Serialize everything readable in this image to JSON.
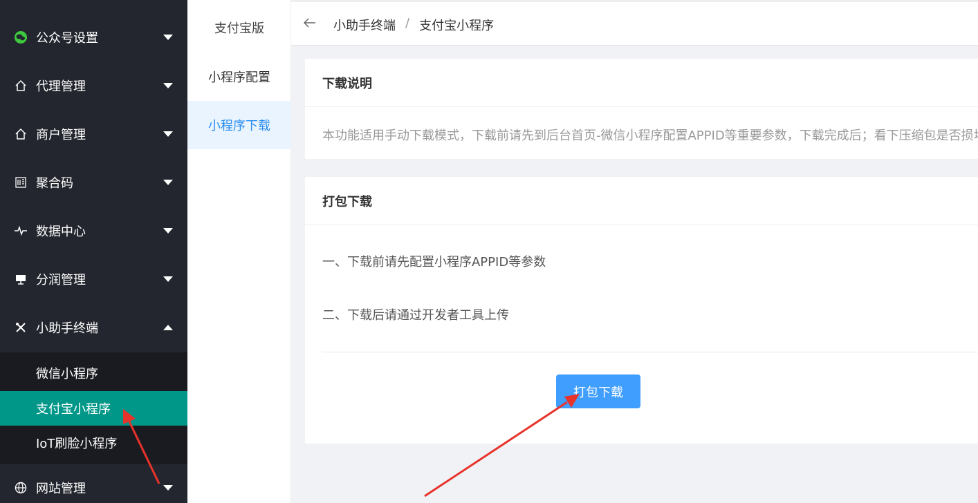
{
  "sidebar": {
    "items": [
      {
        "label": "公众号设置",
        "icon": "wechat-icon"
      },
      {
        "label": "代理管理",
        "icon": "home-icon"
      },
      {
        "label": "商户管理",
        "icon": "home-icon"
      },
      {
        "label": "聚合码",
        "icon": "qrcode-icon"
      },
      {
        "label": "数据中心",
        "icon": "pulse-icon"
      },
      {
        "label": "分润管理",
        "icon": "monitor-icon"
      },
      {
        "label": "小助手终端",
        "icon": "tools-icon"
      },
      {
        "label": "网站管理",
        "icon": "globe-icon"
      }
    ],
    "submenu": [
      {
        "label": "微信小程序"
      },
      {
        "label": "支付宝小程序",
        "active": true
      },
      {
        "label": "IoT刷脸小程序"
      }
    ]
  },
  "subnav": {
    "title": "支付宝版",
    "items": [
      {
        "label": "小程序配置"
      },
      {
        "label": "小程序下载",
        "active": true
      }
    ]
  },
  "header": {
    "back_icon": "arrow-left-icon",
    "breadcrumb": [
      "小助手终端",
      "支付宝小程序"
    ],
    "separator": "/"
  },
  "download_note": {
    "title": "下载说明",
    "text": "本功能适用手动下载模式，下载前请先到后台首页-微信小程序配置APPID等重要参数，下载完成后；看下压缩包是否损坏；"
  },
  "package": {
    "title": "打包下载",
    "line1": "一、下载前请先配置小程序APPID等参数",
    "line2": "二、下载后请通过开发者工具上传",
    "button": "打包下载"
  },
  "colors": {
    "sidebar_bg": "#23262e",
    "submenu_bg": "#1a1b20",
    "active_green": "#009688",
    "primary_blue": "#409eff",
    "annotation_red": "#e8332b"
  }
}
